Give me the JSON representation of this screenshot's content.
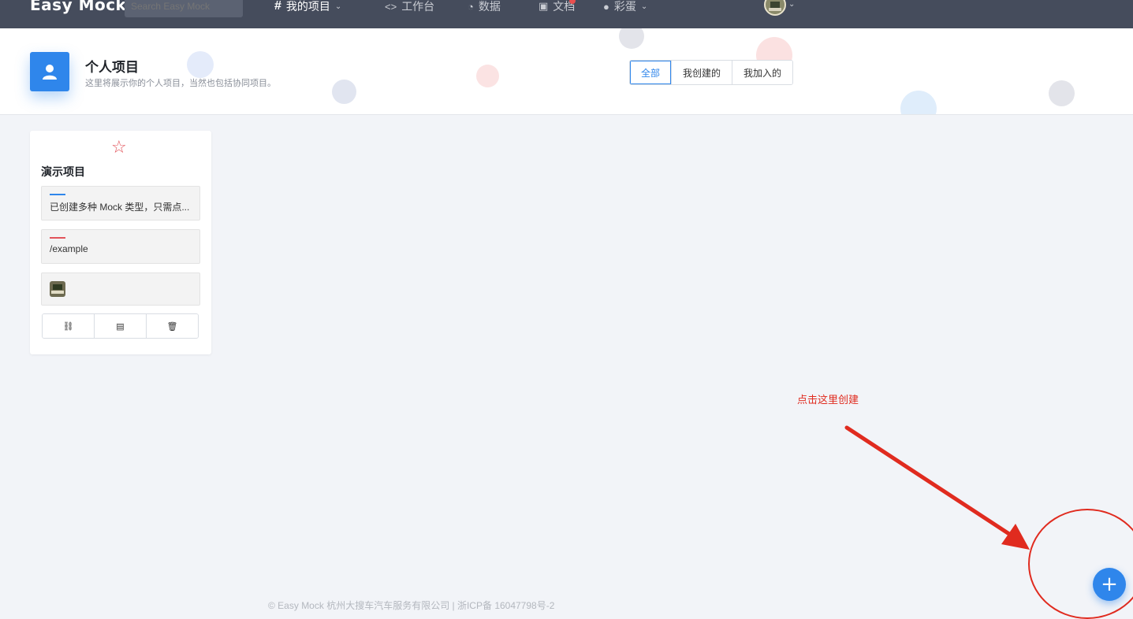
{
  "nav": {
    "logo": "Easy Mock",
    "search_placeholder": "Search Easy Mock",
    "items": [
      {
        "label": "我的项目",
        "icon": "hash-icon",
        "glyph": "#"
      },
      {
        "label": "工作台",
        "icon": "code-icon",
        "glyph": "<>"
      },
      {
        "label": "数据",
        "icon": "dashboard-icon",
        "glyph": "◔"
      },
      {
        "label": "文档",
        "icon": "book-icon",
        "glyph": "▣"
      },
      {
        "label": "彩蛋",
        "icon": "egg-icon",
        "glyph": "●"
      }
    ],
    "caret": "⌄"
  },
  "header": {
    "title": "个人项目",
    "description": "这里将展示你的个人项目，当然也包括协同项目。",
    "filters": [
      "全部",
      "我创建的",
      "我加入的"
    ],
    "active_filter": "全部"
  },
  "project": {
    "star": "☆",
    "name": "演示项目",
    "description": "已创建多种 Mock 类型，只需点...",
    "base_url": "/example",
    "accent_blue": "#2f86eb",
    "accent_red": "#e2535a",
    "actions": [
      "⛓",
      "▤",
      "🗑"
    ]
  },
  "annotation": {
    "note": "点击这里创建",
    "color": "#e02b1f"
  },
  "fab": {
    "label": "+"
  },
  "footer": {
    "text": "© Easy Mock 杭州大搜车汽车服务有限公司 | 浙ICP备 16047798号-2"
  }
}
